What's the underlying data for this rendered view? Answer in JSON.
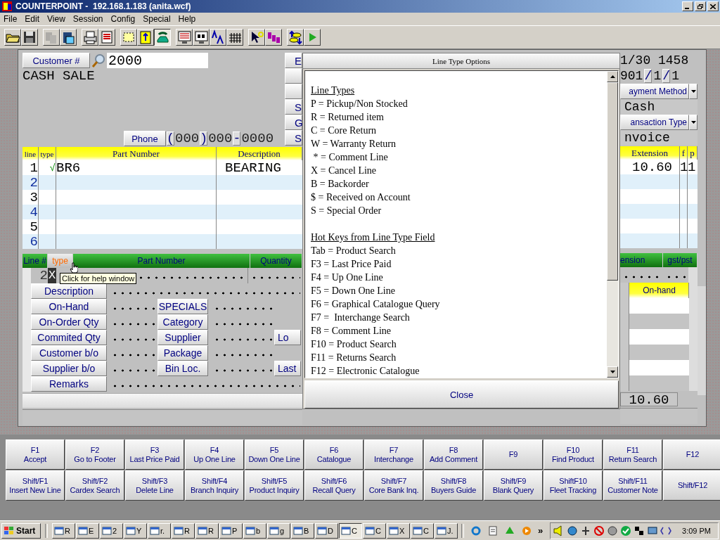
{
  "window": {
    "title": "COUNTERPOINT -  192.168.1.183 (anita.wcf)"
  },
  "menu": [
    "File",
    "Edit",
    "View",
    "Session",
    "Config",
    "Special",
    "Help"
  ],
  "toolbar": [
    {
      "disabled": false,
      "pressed": false
    },
    {
      "disabled": false,
      "pressed": false
    },
    {
      "disabled": true,
      "pressed": false
    },
    {
      "disabled": false,
      "pressed": false
    },
    {
      "disabled": false,
      "pressed": false
    },
    {
      "disabled": false,
      "pressed": false
    },
    {
      "disabled": false,
      "pressed": false
    },
    {
      "disabled": false,
      "pressed": false
    },
    {
      "disabled": false,
      "pressed": true
    },
    {
      "disabled": false,
      "pressed": false
    },
    {
      "disabled": false,
      "pressed": false
    },
    {
      "disabled": false,
      "pressed": false
    },
    {
      "disabled": false,
      "pressed": false
    },
    {
      "disabled": false,
      "pressed": false
    },
    {
      "disabled": false,
      "pressed": false
    },
    {
      "disabled": false,
      "pressed": false
    },
    {
      "disabled": false,
      "pressed": false
    }
  ],
  "customer": {
    "label": "Customer #",
    "value": "2000",
    "name": "CASH SALE"
  },
  "phone": {
    "label": "Phone",
    "parts": [
      "(",
      "000",
      ")",
      "000",
      "-",
      "0000"
    ]
  },
  "side_buttons": [
    {
      "kind": "label",
      "label": "E"
    },
    {
      "kind": "blank"
    },
    {
      "kind": "blank"
    },
    {
      "kind": "label",
      "label": "S"
    },
    {
      "kind": "label",
      "label": "G"
    },
    {
      "kind": "label",
      "label": "S"
    }
  ],
  "header_right": {
    "date": "1/30 1458",
    "ref": [
      "901",
      "/",
      "1",
      "/",
      "1"
    ],
    "payment_label": "ayment Method",
    "payment_value": "Cash",
    "transaction_label": "ansaction Type",
    "transaction_value": "nvoice"
  },
  "lines": {
    "columns": [
      "line",
      "type",
      "Part Number",
      "Description",
      "Extension",
      "f",
      "p"
    ],
    "rows": [
      {
        "line": "1",
        "type": "√",
        "part": "BR6",
        "description": "BEARING",
        "extension": "10.60",
        "f": "1",
        "p": "1"
      },
      {
        "line": "2"
      },
      {
        "line": "3"
      },
      {
        "line": "4"
      },
      {
        "line": "5"
      },
      {
        "line": "6"
      }
    ]
  },
  "entry": {
    "columns": [
      "Line #",
      "type",
      "Part Number",
      "Quantity",
      "ension",
      "gst/pst"
    ],
    "line": "2",
    "type": "X",
    "tooltip": "Click for help window"
  },
  "details": [
    {
      "label": "Description"
    },
    {
      "label": "On-Hand",
      "button": "SPECIALS"
    },
    {
      "label": "On-Order Qty",
      "button": "Category"
    },
    {
      "label": "Commited Qty",
      "button": "Supplier",
      "side_button": "Lo"
    },
    {
      "label": "Customer b/o",
      "button": "Package"
    },
    {
      "label": "Supplier b/o",
      "button": "Bin Loc.",
      "side_button": "Last"
    },
    {
      "label": "Remarks"
    }
  ],
  "onhand_header": "On-hand",
  "total": "10.60",
  "dialog": {
    "title": "Line Type Options",
    "sections": [
      {
        "heading": "Line Types",
        "lines": [
          "P = Pickup/Non Stocked",
          "R = Returned item",
          "C = Core Return",
          "W = Warranty Return",
          " * = Comment Line",
          "X = Cancel Line",
          "B = Backorder",
          "$ = Received on Account",
          "S = Special Order"
        ]
      },
      {
        "heading": "Hot Keys from Line Type Field",
        "lines": [
          "Tab = Product Search",
          "F3 = Last Price Paid",
          "F4 = Up One Line",
          "F5 = Down One Line",
          "F6 = Graphical Catalogue Query",
          "F7 =  Interchange Search",
          "F8 = Comment Line",
          "F10 = Product Search",
          "F11 = Returns Search",
          "F12 = Electronic Catalogue"
        ]
      }
    ],
    "close": "Close"
  },
  "function_keys": [
    [
      {
        "key": "F1",
        "label": "Accept"
      },
      {
        "key": "F2",
        "label": "Go to Footer"
      },
      {
        "key": "F3",
        "label": "Last Price Paid"
      },
      {
        "key": "F4",
        "label": "Up One Line"
      },
      {
        "key": "F5",
        "label": "Down One Line"
      },
      {
        "key": "F6",
        "label": "Catalogue"
      },
      {
        "key": "F7",
        "label": "Interchange"
      },
      {
        "key": "F8",
        "label": "Add Comment"
      },
      {
        "key": "F9"
      },
      {
        "key": "F10",
        "label": "Find Product"
      },
      {
        "key": "F11",
        "label": "Return Search"
      },
      {
        "key": "F12"
      }
    ],
    [
      {
        "key": "Shift/F1",
        "label": "Insert New Line"
      },
      {
        "key": "Shift/F2",
        "label": "Cardex Search"
      },
      {
        "key": "Shift/F3",
        "label": "Delete Line"
      },
      {
        "key": "Shift/F4",
        "label": "Branch Inquiry"
      },
      {
        "key": "Shift/F5",
        "label": "Product Inquiry"
      },
      {
        "key": "Shift/F6",
        "label": "Recall Query"
      },
      {
        "key": "Shift/F7",
        "label": "Core Bank Inq."
      },
      {
        "key": "Shift/F8",
        "label": "Buyers Guide"
      },
      {
        "key": "Shift/F9",
        "label": "Blank Query"
      },
      {
        "key": "ShiftF10",
        "label": "Fleet Tracking"
      },
      {
        "key": "Shift/F11",
        "label": "Customer Note"
      },
      {
        "key": "Shift/F12"
      }
    ]
  ],
  "taskbar": {
    "start": "Start",
    "items": [
      {
        "label": "R",
        "selected": false
      },
      {
        "label": "E",
        "selected": false
      },
      {
        "label": "2",
        "selected": false
      },
      {
        "label": "Y",
        "selected": false
      },
      {
        "label": "r.",
        "selected": false
      },
      {
        "label": "R",
        "selected": false
      },
      {
        "label": "R",
        "selected": false
      },
      {
        "label": "P",
        "selected": false
      },
      {
        "label": "b",
        "selected": false
      },
      {
        "label": "g",
        "selected": false
      },
      {
        "label": "B",
        "selected": false
      },
      {
        "label": "D",
        "selected": false
      },
      {
        "label": "C",
        "selected": true
      },
      {
        "label": "C",
        "selected": false
      },
      {
        "label": "X",
        "selected": false
      },
      {
        "label": "C",
        "selected": false
      },
      {
        "label": "J.",
        "selected": false
      }
    ],
    "chevron": "»",
    "clock": "3:09 PM"
  }
}
